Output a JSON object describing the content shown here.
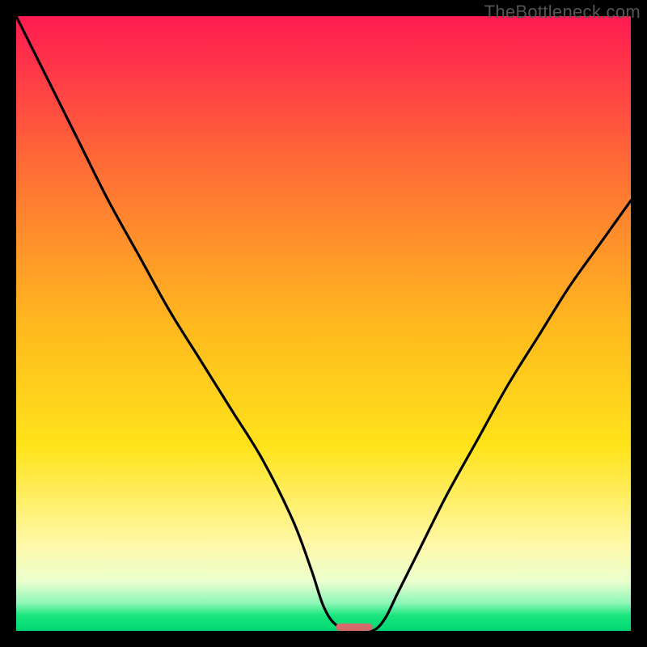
{
  "watermark": "TheBottleneck.com",
  "chart_data": {
    "type": "line",
    "title": "",
    "xlabel": "",
    "ylabel": "",
    "xlim": [
      0,
      100
    ],
    "ylim": [
      0,
      100
    ],
    "grid": false,
    "legend": false,
    "background_gradient": {
      "stops": [
        {
          "offset": 0.0,
          "color": "#ff1a52"
        },
        {
          "offset": 0.25,
          "color": "#ff6e35"
        },
        {
          "offset": 0.5,
          "color": "#ffb81e"
        },
        {
          "offset": 0.7,
          "color": "#ffe31a"
        },
        {
          "offset": 0.86,
          "color": "#fff8a8"
        },
        {
          "offset": 0.92,
          "color": "#eaffcf"
        },
        {
          "offset": 0.955,
          "color": "#8cf6b6"
        },
        {
          "offset": 0.975,
          "color": "#19e57d"
        },
        {
          "offset": 1.0,
          "color": "#00d874"
        }
      ]
    },
    "series": [
      {
        "name": "bottleneck-curve",
        "color": "#000000",
        "x": [
          0,
          5,
          10,
          15,
          20,
          25,
          30,
          35,
          40,
          45,
          48,
          50,
          52,
          55,
          58,
          60,
          62,
          65,
          70,
          75,
          80,
          85,
          90,
          95,
          100
        ],
        "y": [
          100,
          90,
          80,
          70,
          61,
          52,
          44,
          36,
          28,
          18,
          10,
          4,
          1,
          0,
          0,
          2,
          6,
          12,
          22,
          31,
          40,
          48,
          56,
          63,
          70
        ]
      }
    ],
    "marker": {
      "name": "optimum-marker",
      "shape": "rounded-rect",
      "color": "#d56a6a",
      "x_center": 55,
      "y_center": 0,
      "width_pct": 6,
      "height_pct": 1.2
    }
  }
}
